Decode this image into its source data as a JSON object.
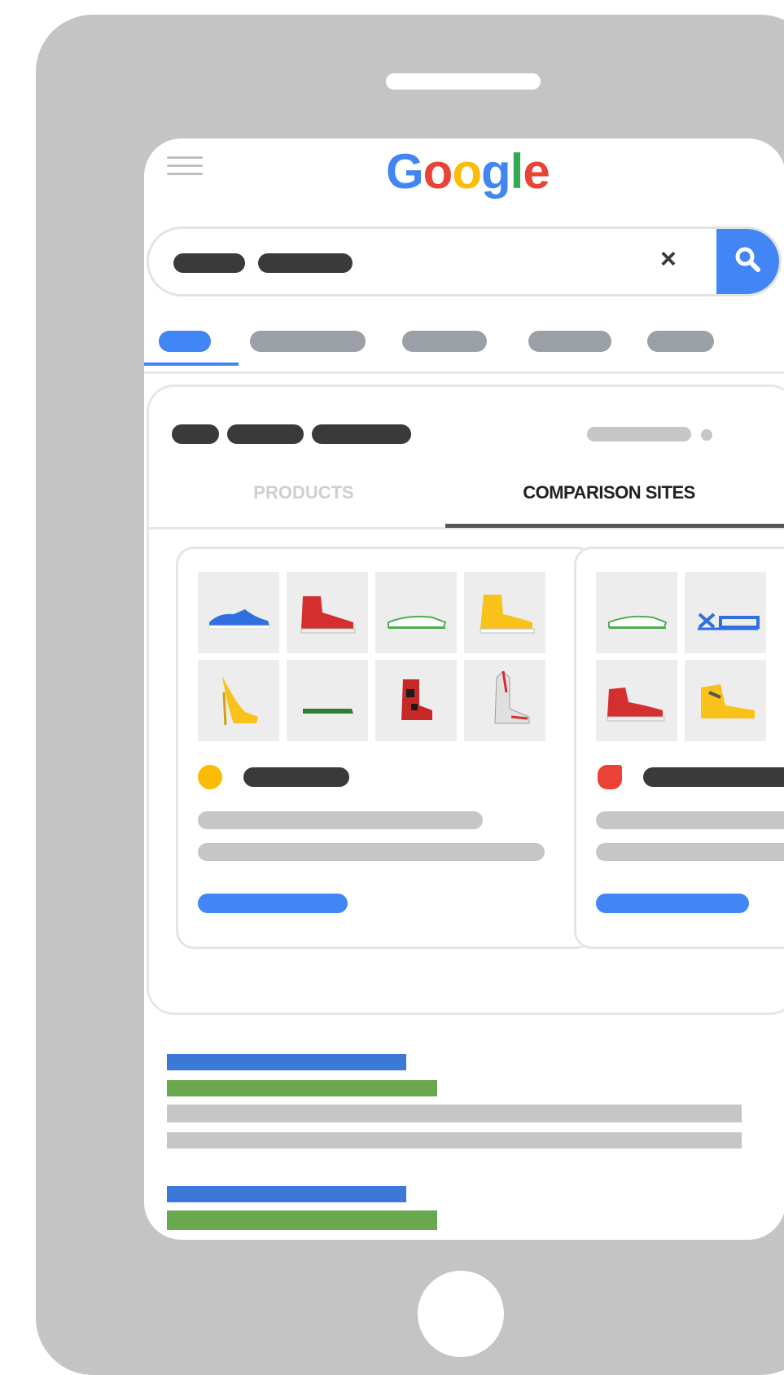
{
  "browser": {
    "logo_letters": [
      {
        "char": "G",
        "color": "#4285F4"
      },
      {
        "char": "o",
        "color": "#EA4335"
      },
      {
        "char": "o",
        "color": "#FBBC05"
      },
      {
        "char": "g",
        "color": "#4285F4"
      },
      {
        "char": "l",
        "color": "#34A853"
      },
      {
        "char": "e",
        "color": "#EA4335"
      }
    ],
    "clear_symbol": "×"
  },
  "shopping_panel": {
    "tabs": {
      "products": "PRODUCTS",
      "comparison_sites": "COMPARISON SITES"
    },
    "selected_tab": "COMPARISON SITES",
    "store_cards": [
      {
        "icon": "yellow-circle-icon",
        "icon_color": "#FBBC05",
        "products": [
          "blue-sneaker",
          "red-high-top",
          "green-slip-on",
          "yellow-boot",
          "yellow-high-heel",
          "green-loafer",
          "red-boot",
          "cowboy-boot"
        ]
      },
      {
        "icon": "red-tag-icon",
        "icon_color": "#EA4335",
        "products": [
          "green-slip-on",
          "blue-sandal",
          "red-high-top",
          "yellow-sneaker"
        ]
      }
    ]
  },
  "colors": {
    "accent_blue": "#4285F4",
    "accent_green": "#6AA84F",
    "frame_gray": "#C4C4C4",
    "placeholder_dark": "#3A3A3A",
    "placeholder_light": "#C6C6C6"
  }
}
